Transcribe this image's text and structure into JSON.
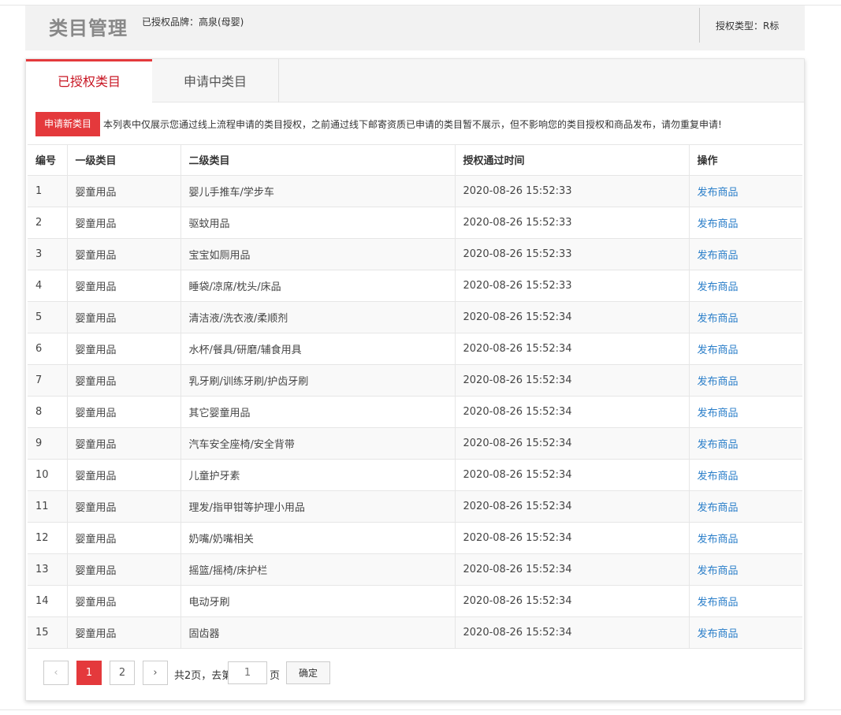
{
  "header": {
    "title": "类目管理",
    "brand": "已授权品牌：高泉(母婴)",
    "auth_type": "授权类型：R标"
  },
  "tabs": [
    {
      "label": "已授权类目",
      "active": true
    },
    {
      "label": "申请中类目",
      "active": false
    }
  ],
  "notice": {
    "button_label": "申请新类目",
    "text": "本列表中仅展示您通过线上流程申请的类目授权，之前通过线下邮寄资质已申请的类目暂不展示，但不影响您的类目授权和商品发布，请勿重复申请!"
  },
  "table": {
    "columns": [
      "编号",
      "一级类目",
      "二级类目",
      "授权通过时间",
      "操作"
    ],
    "rows": [
      {
        "id": "1",
        "level1": "婴童用品",
        "level2": "婴儿手推车/学步车",
        "time": "2020-08-26 15:52:33",
        "action": "发布商品"
      },
      {
        "id": "2",
        "level1": "婴童用品",
        "level2": "驱蚊用品",
        "time": "2020-08-26 15:52:33",
        "action": "发布商品"
      },
      {
        "id": "3",
        "level1": "婴童用品",
        "level2": "宝宝如厕用品",
        "time": "2020-08-26 15:52:33",
        "action": "发布商品"
      },
      {
        "id": "4",
        "level1": "婴童用品",
        "level2": "睡袋/凉席/枕头/床品",
        "time": "2020-08-26 15:52:33",
        "action": "发布商品"
      },
      {
        "id": "5",
        "level1": "婴童用品",
        "level2": "清洁液/洗衣液/柔顺剂",
        "time": "2020-08-26 15:52:34",
        "action": "发布商品"
      },
      {
        "id": "6",
        "level1": "婴童用品",
        "level2": "水杯/餐具/研磨/辅食用具",
        "time": "2020-08-26 15:52:34",
        "action": "发布商品"
      },
      {
        "id": "7",
        "level1": "婴童用品",
        "level2": "乳牙刷/训练牙刷/护齿牙刷",
        "time": "2020-08-26 15:52:34",
        "action": "发布商品"
      },
      {
        "id": "8",
        "level1": "婴童用品",
        "level2": "其它婴童用品",
        "time": "2020-08-26 15:52:34",
        "action": "发布商品"
      },
      {
        "id": "9",
        "level1": "婴童用品",
        "level2": "汽车安全座椅/安全背带",
        "time": "2020-08-26 15:52:34",
        "action": "发布商品"
      },
      {
        "id": "10",
        "level1": "婴童用品",
        "level2": "儿童护牙素",
        "time": "2020-08-26 15:52:34",
        "action": "发布商品"
      },
      {
        "id": "11",
        "level1": "婴童用品",
        "level2": "理发/指甲钳等护理小用品",
        "time": "2020-08-26 15:52:34",
        "action": "发布商品"
      },
      {
        "id": "12",
        "level1": "婴童用品",
        "level2": "奶嘴/奶嘴相关",
        "time": "2020-08-26 15:52:34",
        "action": "发布商品"
      },
      {
        "id": "13",
        "level1": "婴童用品",
        "level2": "摇篮/摇椅/床护栏",
        "time": "2020-08-26 15:52:34",
        "action": "发布商品"
      },
      {
        "id": "14",
        "level1": "婴童用品",
        "level2": "电动牙刷",
        "time": "2020-08-26 15:52:34",
        "action": "发布商品"
      },
      {
        "id": "15",
        "level1": "婴童用品",
        "level2": "固齿器",
        "time": "2020-08-26 15:52:34",
        "action": "发布商品"
      }
    ]
  },
  "pagination": {
    "prev_icon": "chevron-left-icon",
    "next_icon": "chevron-right-icon",
    "prev_glyph": "‹",
    "next_glyph": "›",
    "pages": [
      "1",
      "2"
    ],
    "current": "1",
    "total_text": "共2页，去第",
    "goto_value": "1",
    "unit_text": "页",
    "confirm_label": "确定"
  },
  "colors": {
    "accent": "#e4393c",
    "link": "#2a7ec9"
  }
}
